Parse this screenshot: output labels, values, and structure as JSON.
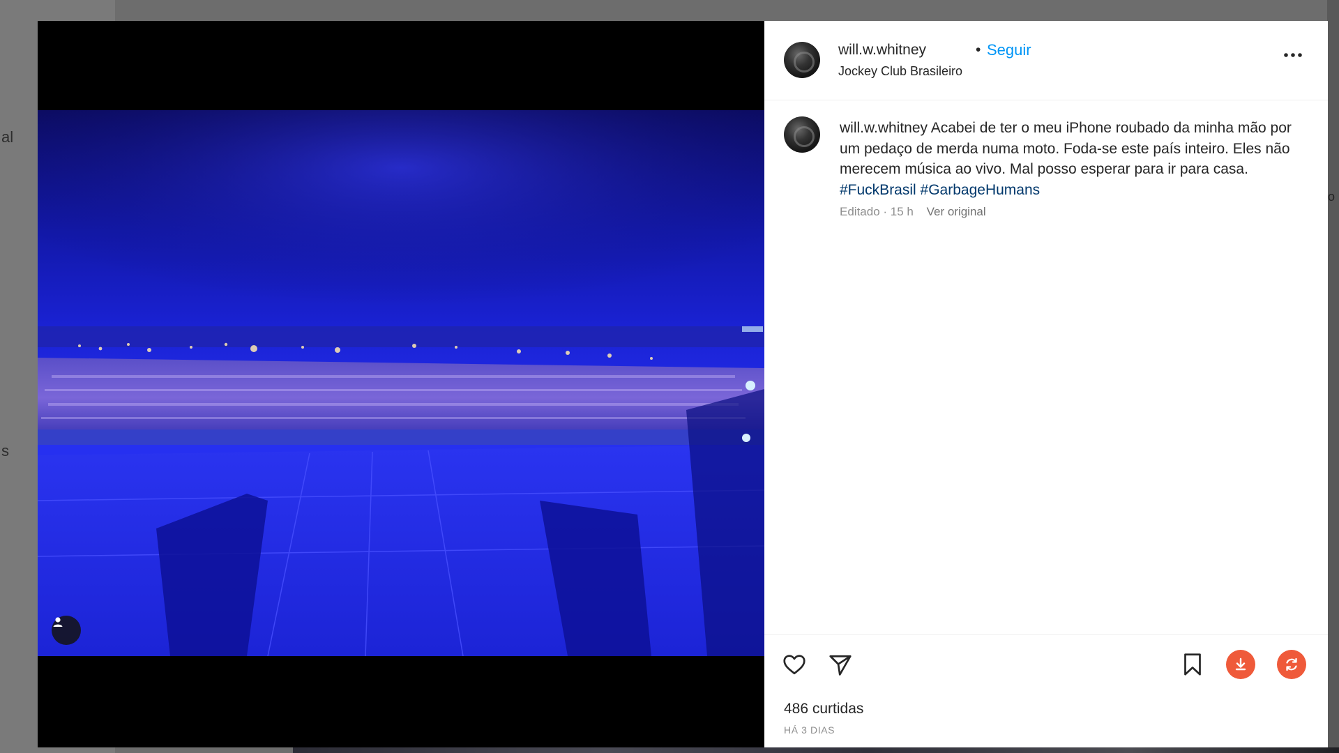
{
  "background": {
    "left_fragments": [
      "al",
      "s"
    ],
    "right_fragment": "o"
  },
  "post": {
    "username": "will.w.whitney",
    "separator": "•",
    "follow_label": "Seguir",
    "location": "Jockey Club Brasileiro",
    "caption": {
      "username": "will.w.whitney",
      "text": "Acabei de ter o meu iPhone roubado da minha mão por um pedaço de merda numa moto. Foda-se este país inteiro. Eles não merecem música ao vivo. Mal posso esperar para ir para casa.",
      "hashtags": [
        "#FuckBrasil",
        "#GarbageHumans"
      ],
      "edited_label": "Editado · 15 h",
      "see_original_label": "Ver original"
    },
    "likes": "486 curtidas",
    "posted": "HÁ 3 DIAS"
  },
  "icons": {
    "more": "more-options-icon",
    "like": "heart-icon",
    "share": "send-icon",
    "save": "bookmark-icon",
    "download": "download-icon",
    "repost": "refresh-icon",
    "tag": "person-icon"
  },
  "colors": {
    "link": "#0095f6",
    "hashtag": "#00376b",
    "accent_button": "#ef5a3a",
    "photo_blue": "#1a22d4"
  }
}
